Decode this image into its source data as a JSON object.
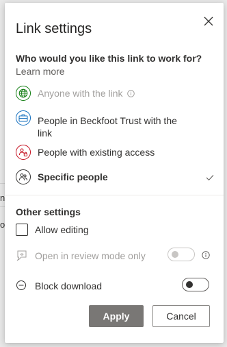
{
  "background": {
    "fragment_1": "ng",
    "fragment_2": "o"
  },
  "dialog": {
    "title": "Link settings",
    "question": "Who would you like this link to work for?",
    "learn_more": "Learn more",
    "options": [
      {
        "label": "Anyone with the link",
        "disabled": true,
        "icon": "globe-icon"
      },
      {
        "label": "People in Beckfoot Trust with the link",
        "disabled": false,
        "icon": "briefcase-icon"
      },
      {
        "label": "People with existing access",
        "disabled": false,
        "icon": "people-lock-icon"
      },
      {
        "label": "Specific people",
        "disabled": false,
        "selected": true,
        "icon": "people-icon"
      }
    ],
    "other_settings_title": "Other settings",
    "allow_editing": {
      "label": "Allow editing",
      "checked": false
    },
    "review_mode": {
      "label": "Open in review mode only",
      "disabled": true,
      "on": false
    },
    "block_download": {
      "label": "Block download",
      "on": false
    },
    "apply_label": "Apply",
    "cancel_label": "Cancel"
  },
  "colors": {
    "globe": "#107c10",
    "briefcase": "#0f6cbd",
    "people_lock": "#c50f1f",
    "people": "#323130",
    "apply_bg": "#797775"
  }
}
